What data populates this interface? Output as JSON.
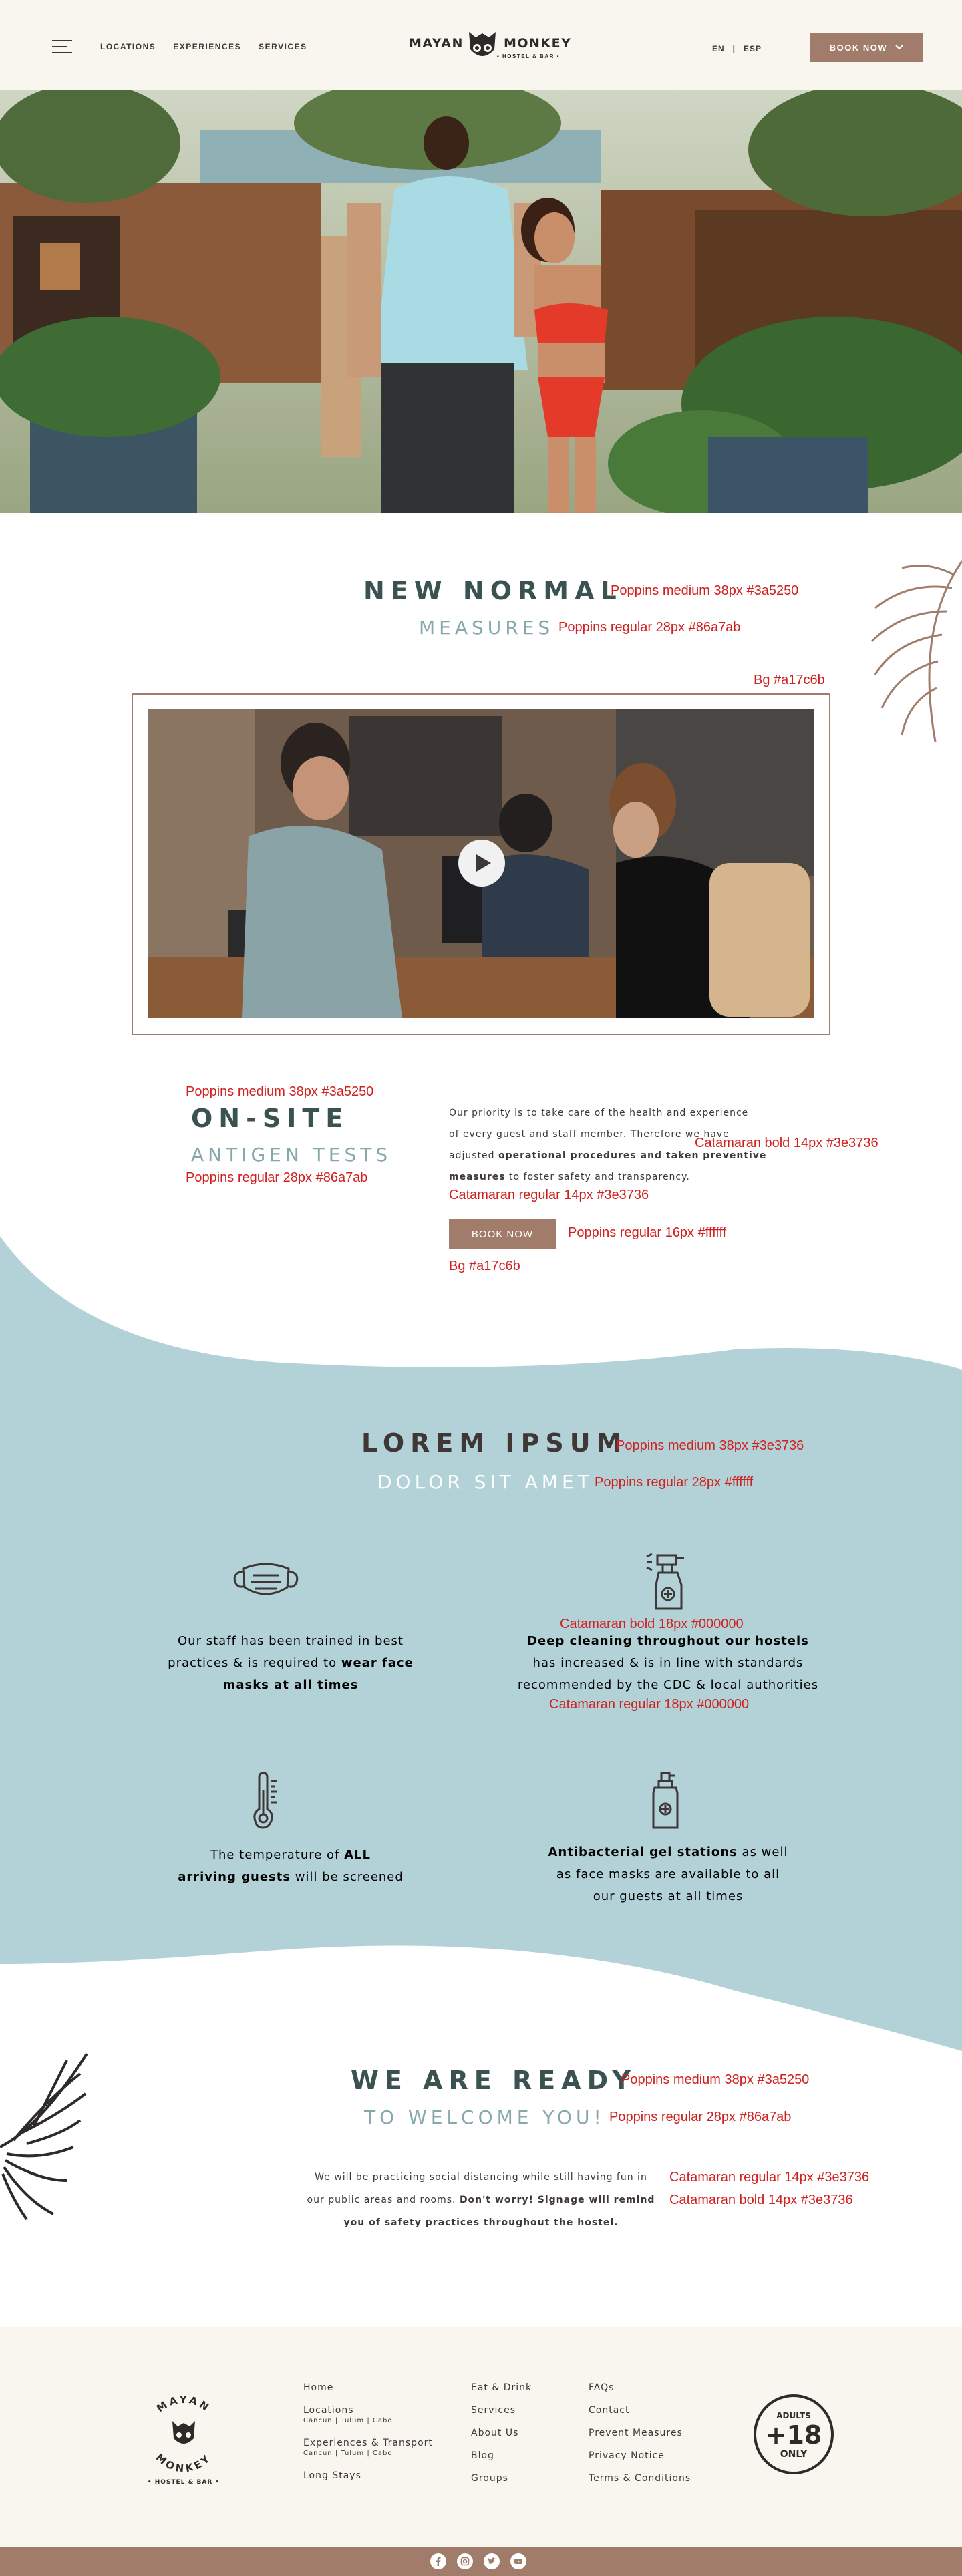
{
  "header": {
    "nav": [
      "LOCATIONS",
      "EXPERIENCES",
      "SERVICES"
    ],
    "logo_left": "MAYAN",
    "logo_right": "MONKEY",
    "logo_sub": "• HOSTEL & BAR •",
    "lang_en": "EN",
    "lang_sep": "|",
    "lang_esp": "ESP",
    "book_now": "BOOK NOW"
  },
  "new_normal": {
    "title": "NEW NORMAL",
    "subtitle": "MEASURES"
  },
  "onsite": {
    "title": "ON-SITE",
    "subtitle": "ANTIGEN TESTS",
    "body_1": "Our priority is to take care of the health and experience",
    "body_2": "of every guest and staff member. Therefore we have",
    "body_3a": "adjusted ",
    "body_3b": "operational procedures and taken preventive",
    "body_4a": "measures",
    "body_4b": " to foster safety and transparency.",
    "button": "BOOK NOW"
  },
  "lorem": {
    "title": "LOREM IPSUM",
    "subtitle": "DOLOR SIT AMET"
  },
  "features": {
    "mask_1": "Our staff has been trained in best",
    "mask_2a": "practices & is required to ",
    "mask_2b": "wear face",
    "mask_3": "masks at all times",
    "clean_1": "Deep cleaning throughout our hostels",
    "clean_2": "has increased & is in line with standards",
    "clean_3": "recommended by the CDC & local authorities",
    "temp_1a": "The temperature of ",
    "temp_1b": "ALL",
    "temp_2a": "arriving guests",
    "temp_2b": " will be screened",
    "gel_1a": "Antibacterial gel stations",
    "gel_1b": " as well",
    "gel_2": "as face masks are available to all",
    "gel_3": "our guests at all times"
  },
  "ready": {
    "title": "WE ARE READY",
    "subtitle": "TO WELCOME YOU!",
    "text_1": "We will be practicing social distancing while still having fun in",
    "text_2a": "our public areas and rooms. ",
    "text_2b": "Don't worry! Signage will remind",
    "text_3a": "you ",
    "text_3b": " of safety practices throughout the hostel."
  },
  "annotations": {
    "a1": "Poppins medium 38px #3a5250",
    "a2": "Poppins regular 28px #86a7ab",
    "a3": "Bg #a17c6b",
    "a4": "Poppins medium 38px #3a5250",
    "a5": "Poppins regular 28px #86a7ab",
    "a6": "Catamaran bold 14px #3e3736",
    "a7": "Catamaran regular 14px #3e3736",
    "a8": "Poppins regular 16px #ffffff",
    "a9": "Bg #a17c6b",
    "a10": "Poppins medium 38px #3e3736",
    "a11": "Poppins regular 28px #ffffff",
    "a12": "Catamaran bold 18px #000000",
    "a13": "Catamaran regular 18px #000000",
    "a14": "Poppins medium 38px #3a5250",
    "a15": "Poppins regular 28px #86a7ab",
    "a16": "Catamaran regular 14px #3e3736",
    "a17": "Catamaran bold 14px #3e3736"
  },
  "footer": {
    "col1": [
      "Home",
      "Locations",
      "Experiences & Transport",
      "Long Stays"
    ],
    "col1_sub": "Cancun | Tulum | Cabo",
    "col2": [
      "Eat & Drink",
      "Services",
      "About Us",
      "Blog",
      "Groups"
    ],
    "col3": [
      "FAQs",
      "Contact",
      "Prevent Measures",
      "Privacy Notice",
      "Terms & Conditions"
    ],
    "badge_top": "ADULTS",
    "badge_mid": "+18",
    "badge_bot": "ONLY",
    "seal_top": "MAYAN",
    "seal_bottom": "MONKEY",
    "seal_sub": "• HOSTEL & BAR •"
  },
  "social_icons": [
    "facebook-icon",
    "instagram-icon",
    "twitter-icon",
    "youtube-icon"
  ],
  "colors": {
    "brand_brown": "#a17c6b",
    "dark_teal": "#3a5250",
    "light_teal": "#86a7ab",
    "teal_bg": "#b3d2d7",
    "cream": "#f9f5ef",
    "text": "#3e3736",
    "annotation": "#d0201f"
  }
}
